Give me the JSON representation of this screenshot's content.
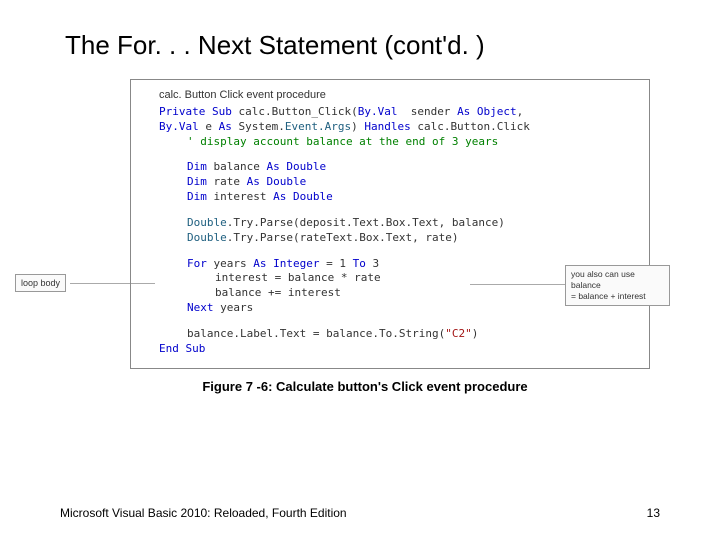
{
  "title": "The For. . . Next Statement (cont'd. )",
  "code": {
    "header": "calc. Button Click event procedure",
    "l1a": "Private Sub",
    "l1b": " calc.Button_Click(",
    "l1c": "By.Val",
    "l1d": "  sender ",
    "l1e": "As Object",
    "l1f": ",",
    "l2a": "By.Val",
    "l2b": " e ",
    "l2c": "As",
    "l2d": " System.",
    "l2e": "Event.Args",
    "l2f": ") ",
    "l2g": "Handles",
    "l2h": " calc.Button.Click",
    "l3": "' display account balance at the end of 3 years",
    "l4a": "Dim",
    "l4b": " balance ",
    "l4c": "As Double",
    "l5a": "Dim",
    "l5b": " rate ",
    "l5c": "As Double",
    "l6a": "Dim",
    "l6b": " interest ",
    "l6c": "As Double",
    "l7a": "Double",
    "l7b": ".Try.Parse(deposit.Text.Box.Text, balance)",
    "l8a": "Double",
    "l8b": ".Try.Parse(rateText.Box.Text, rate)",
    "l9a": "For",
    "l9b": " years ",
    "l9c": "As Integer",
    "l9d": " = 1 ",
    "l9e": "To",
    "l9f": " 3",
    "l10": "interest = balance * rate",
    "l11": "balance += interest",
    "l12a": "Next",
    "l12b": " years",
    "l13a": "balance.Label.Text = balance.To.String(",
    "l13b": "\"C2\"",
    "l13c": ")",
    "l14": "End Sub"
  },
  "callout_left": "loop body",
  "callout_right_l1": "you also can use balance",
  "callout_right_l2": "= balance + interest",
  "caption": "Figure 7 -6: Calculate button's Click event procedure",
  "footer_left": "Microsoft Visual Basic 2010: Reloaded, Fourth Edition",
  "footer_right": "13"
}
